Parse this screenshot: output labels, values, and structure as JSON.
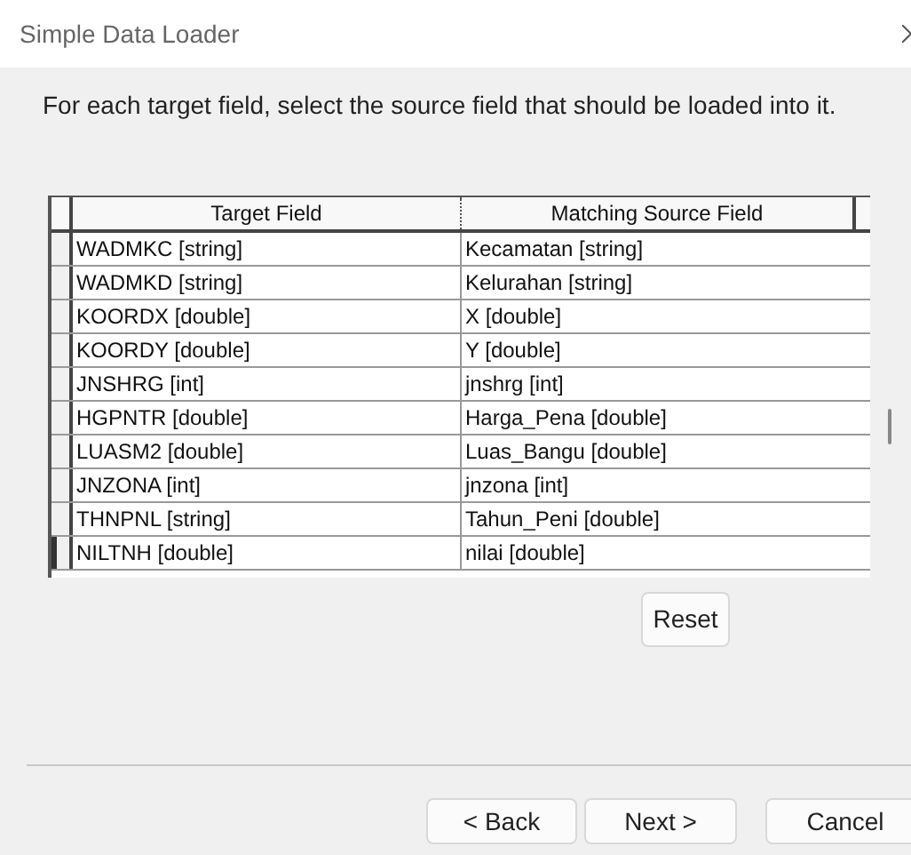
{
  "window": {
    "title": "Simple Data Loader"
  },
  "instruction": "For each target field, select the source field that should be loaded into it.",
  "table": {
    "columns": [
      "Target Field",
      "Matching Source Field"
    ],
    "rows": [
      {
        "target": "WADMKC [string]",
        "source": "Kecamatan [string]",
        "selected": false
      },
      {
        "target": "WADMKD [string]",
        "source": "Kelurahan [string]",
        "selected": false
      },
      {
        "target": "KOORDX [double]",
        "source": "X [double]",
        "selected": false
      },
      {
        "target": "KOORDY [double]",
        "source": "Y [double]",
        "selected": false
      },
      {
        "target": "JNSHRG [int]",
        "source": "jnshrg [int]",
        "selected": false
      },
      {
        "target": "HGPNTR [double]",
        "source": "Harga_Pena [double]",
        "selected": false
      },
      {
        "target": "LUASM2 [double]",
        "source": "Luas_Bangu [double]",
        "selected": false
      },
      {
        "target": "JNZONA [int]",
        "source": "jnzona [int]",
        "selected": false
      },
      {
        "target": "THNPNL [string]",
        "source": "Tahun_Peni [double]",
        "selected": false
      },
      {
        "target": "NILTNH [double]",
        "source": "nilai [double]",
        "selected": true
      }
    ]
  },
  "reset_button": "Reset",
  "buttons": [
    "< Back",
    "Next >",
    "Cancel"
  ]
}
